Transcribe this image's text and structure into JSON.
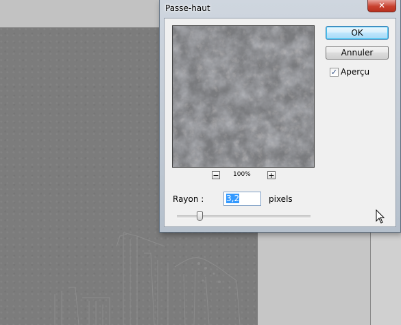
{
  "dialog": {
    "title": "Passe-haut",
    "close_label": "✕",
    "ok_label": "OK",
    "cancel_label": "Annuler",
    "preview_checkbox": {
      "label": "Aperçu",
      "checked": true
    },
    "zoom": {
      "minus": "−",
      "level": "100%",
      "plus": "+"
    },
    "radius": {
      "label": "Rayon :",
      "value": "3,2",
      "unit": "pixels",
      "slider_value_fraction": 0.17
    }
  },
  "icons": {
    "close": "close-icon",
    "checkmark": "checkmark-icon",
    "cursor": "arrow-cursor-icon"
  },
  "colors": {
    "canvas_gray": "#7c7c7c",
    "preview_gray": "#7a7b7e",
    "close_red": "#c8412f",
    "ok_border": "#3c7fb1",
    "selection_blue": "#3399ff"
  }
}
